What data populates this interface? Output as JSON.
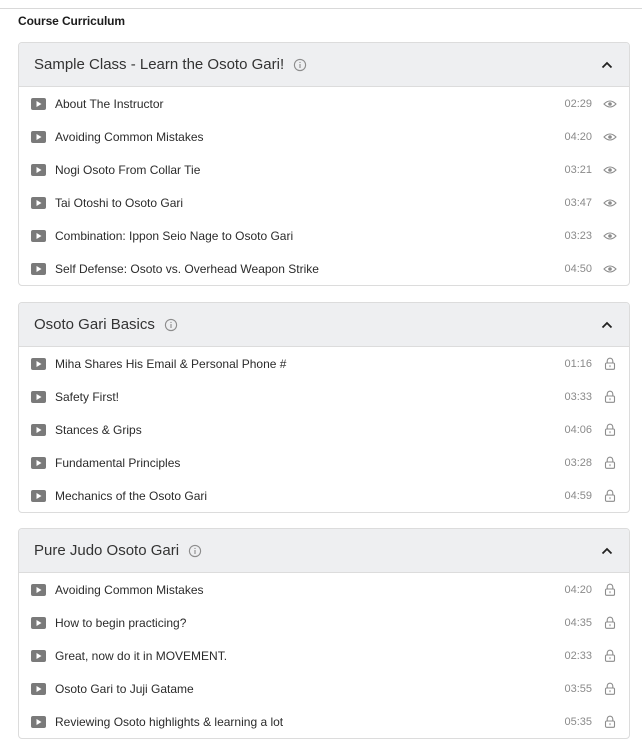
{
  "page": {
    "title": "Course Curriculum"
  },
  "sections": [
    {
      "title": "Sample Class - Learn the Osoto Gari!",
      "lessons": [
        {
          "title": "About The Instructor",
          "duration": "02:29",
          "status": "eye-icon"
        },
        {
          "title": "Avoiding Common Mistakes",
          "duration": "04:20",
          "status": "eye-icon"
        },
        {
          "title": "Nogi Osoto From Collar Tie",
          "duration": "03:21",
          "status": "eye-icon"
        },
        {
          "title": "Tai Otoshi to Osoto Gari",
          "duration": "03:47",
          "status": "eye-icon"
        },
        {
          "title": "Combination: Ippon Seio Nage to Osoto Gari",
          "duration": "03:23",
          "status": "eye-icon"
        },
        {
          "title": "Self Defense: Osoto vs. Overhead Weapon Strike",
          "duration": "04:50",
          "status": "eye-icon"
        }
      ]
    },
    {
      "title": "Osoto Gari Basics",
      "lessons": [
        {
          "title": "Miha Shares His Email & Personal Phone #",
          "duration": "01:16",
          "status": "lock-icon"
        },
        {
          "title": "Safety First!",
          "duration": "03:33",
          "status": "lock-icon"
        },
        {
          "title": "Stances & Grips",
          "duration": "04:06",
          "status": "lock-icon"
        },
        {
          "title": "Fundamental Principles",
          "duration": "03:28",
          "status": "lock-icon"
        },
        {
          "title": "Mechanics of the Osoto Gari",
          "duration": "04:59",
          "status": "lock-icon"
        }
      ]
    },
    {
      "title": "Pure Judo Osoto Gari",
      "lessons": [
        {
          "title": "Avoiding Common Mistakes",
          "duration": "04:20",
          "status": "lock-icon"
        },
        {
          "title": "How to begin practicing?",
          "duration": "04:35",
          "status": "lock-icon"
        },
        {
          "title": "Great, now do it in MOVEMENT.",
          "duration": "02:33",
          "status": "lock-icon"
        },
        {
          "title": "Osoto Gari to Juji Gatame",
          "duration": "03:55",
          "status": "lock-icon"
        },
        {
          "title": "Reviewing Osoto highlights & learning a lot",
          "duration": "05:35",
          "status": "lock-icon"
        }
      ]
    }
  ],
  "colors": {
    "header_bg": "#eeeff1",
    "border": "#dcdcdc",
    "icon": "#8c8c8c",
    "play": "#7a7a7a"
  }
}
